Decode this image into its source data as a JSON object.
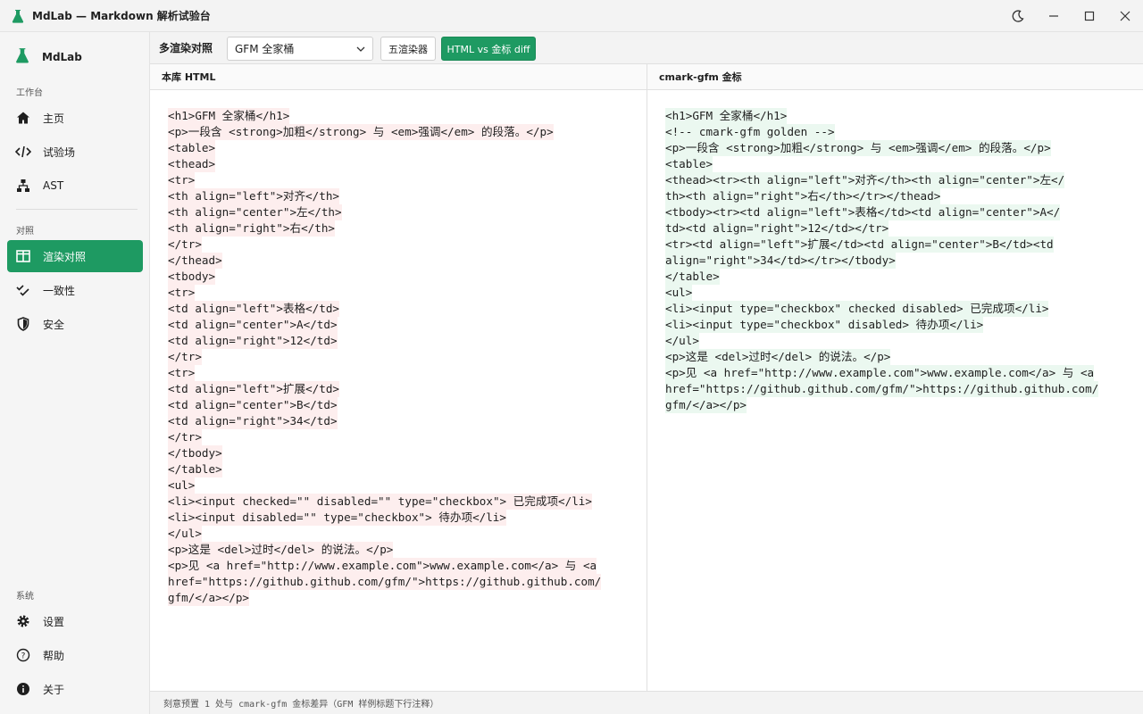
{
  "window": {
    "title": "MdLab — Markdown 解析试验台",
    "controls": [
      "moon-icon",
      "minimize-icon",
      "maximize-icon",
      "close-icon"
    ]
  },
  "sidebar": {
    "brand": "MdLab",
    "sections": [
      {
        "label": "工作台",
        "items": [
          {
            "label": "主页",
            "icon": "home-icon"
          },
          {
            "label": "试验场",
            "icon": "code-icon"
          },
          {
            "label": "AST",
            "icon": "tree-icon"
          }
        ]
      },
      {
        "label": "对照",
        "items": [
          {
            "label": "渲染对照",
            "icon": "columns-icon",
            "active": true
          },
          {
            "label": "一致性",
            "icon": "checklist-icon"
          },
          {
            "label": "安全",
            "icon": "shield-icon"
          }
        ]
      },
      {
        "label": "系统",
        "items": [
          {
            "label": "设置",
            "icon": "gear-icon"
          },
          {
            "label": "帮助",
            "icon": "help-icon"
          },
          {
            "label": "关于",
            "icon": "info-icon"
          }
        ]
      }
    ]
  },
  "toolbar": {
    "label": "多渲染对照",
    "select_value": "GFM 全家桶",
    "btn_five": "五渲染器",
    "btn_diff": "HTML vs 金标 diff"
  },
  "panes": {
    "left_title": "本库 HTML",
    "right_title": "cmark-gfm 金标",
    "left_lines": [
      "<h1>GFM 全家桶</h1>",
      "<p>一段含 <strong>加粗</strong> 与 <em>强调</em> 的段落。</p>",
      "<table>",
      "<thead>",
      "<tr>",
      "<th align=\"left\">对齐</th>",
      "<th align=\"center\">左</th>",
      "<th align=\"right\">右</th>",
      "</tr>",
      "</thead>",
      "<tbody>",
      "<tr>",
      "<td align=\"left\">表格</td>",
      "<td align=\"center\">A</td>",
      "<td align=\"right\">12</td>",
      "</tr>",
      "<tr>",
      "<td align=\"left\">扩展</td>",
      "<td align=\"center\">B</td>",
      "<td align=\"right\">34</td>",
      "</tr>",
      "</tbody>",
      "</table>",
      "<ul>",
      "<li><input checked=\"\" disabled=\"\" type=\"checkbox\"> 已完成项</li>",
      "<li><input disabled=\"\" type=\"checkbox\"> 待办项</li>",
      "</ul>",
      "<p>这是 <del>过时</del> 的说法。</p>",
      "<p>见 <a href=\"http://www.example.com\">www.example.com</a> 与 <a",
      "href=\"https://github.github.com/gfm/\">https://github.github.com/",
      "gfm/</a></p>"
    ],
    "right_lines": [
      "<h1>GFM 全家桶</h1>",
      "<!-- cmark-gfm golden -->",
      "<p>一段含 <strong>加粗</strong> 与 <em>强调</em> 的段落。</p>",
      "<table>",
      "<thead><tr><th align=\"left\">对齐</th><th align=\"center\">左</",
      "th><th align=\"right\">右</th></tr></thead>",
      "<tbody><tr><td align=\"left\">表格</td><td align=\"center\">A</",
      "td><td align=\"right\">12</td></tr>",
      "<tr><td align=\"left\">扩展</td><td align=\"center\">B</td><td",
      "align=\"right\">34</td></tr></tbody>",
      "</table>",
      "<ul>",
      "<li><input type=\"checkbox\" checked disabled> 已完成项</li>",
      "<li><input type=\"checkbox\" disabled> 待办项</li>",
      "</ul>",
      "<p>这是 <del>过时</del> 的说法。</p>",
      "<p>见 <a href=\"http://www.example.com\">www.example.com</a> 与 <a",
      "href=\"https://github.github.com/gfm/\">https://github.github.com/",
      "gfm/</a></p>"
    ]
  },
  "status": "刻意预置 1 处与 cmark-gfm 金标差异（GFM 样例标题下行注释）",
  "colors": {
    "accent": "#1e9a62",
    "diff_left": "#fdeeee",
    "diff_right": "#ebf8f0"
  }
}
